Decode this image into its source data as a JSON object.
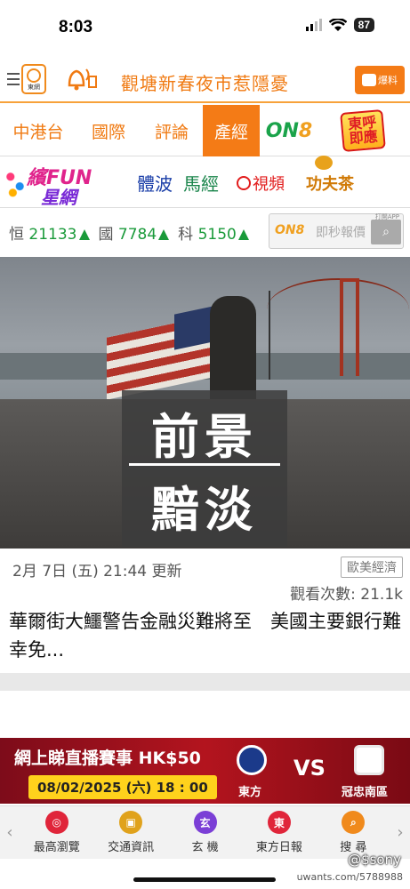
{
  "status": {
    "time": "8:03",
    "battery": "87"
  },
  "appbar": {
    "logo_text": "東網",
    "headline": "觀塘新春夜市惹隱憂",
    "report_label": "爆料"
  },
  "nav": {
    "tabs": [
      "中港台",
      "國際",
      "評論",
      "產經"
    ],
    "active_index": 3,
    "on8_a": "ON",
    "on8_b": "8",
    "dongfu_1": "東呼",
    "dongfu_2": "即應"
  },
  "channels": {
    "fun_1": "繽FUN",
    "fun_2": "星網",
    "sports": "體波",
    "horse": "馬經",
    "video": "視頻",
    "tea": "功夫茶"
  },
  "indices": [
    {
      "name": "恒",
      "value": "21133"
    },
    {
      "name": "國",
      "value": "7784"
    },
    {
      "name": "科",
      "value": "5150"
    }
  ],
  "quote": {
    "logo": "ON8",
    "label": "即秒報價",
    "app_label": "打開APP"
  },
  "hero": {
    "line1": "前景",
    "line2": "黯淡"
  },
  "article": {
    "date": "2月 7日 (五) 21:44 更新",
    "category": "歐美經濟",
    "views": "觀看次數: 21.1k",
    "headline": "華爾街大鱷警告金融災難將至　美國主要銀行難幸免..."
  },
  "banner": {
    "title": "網上睇直播賽事 HK$50",
    "datetime": "08/02/2025 (六) 18 : 00",
    "vs": "VS",
    "team_home": "東方",
    "team_away": "冠忠南區"
  },
  "tabbar": {
    "items": [
      {
        "label": "最高瀏覽",
        "color": "#e0253a",
        "glyph": "◎"
      },
      {
        "label": "交通資訊",
        "color": "#e0a21c",
        "glyph": "▣"
      },
      {
        "label": "玄 機",
        "color": "#7b3fd6",
        "glyph": "玄"
      },
      {
        "label": "東方日報",
        "color": "#e0253a",
        "glyph": "東"
      },
      {
        "label": "搜 尋",
        "color": "#f08a1c",
        "glyph": "⌕"
      }
    ]
  },
  "watermark": {
    "handle": "@$sony",
    "site": "uwants.com/5788988"
  }
}
